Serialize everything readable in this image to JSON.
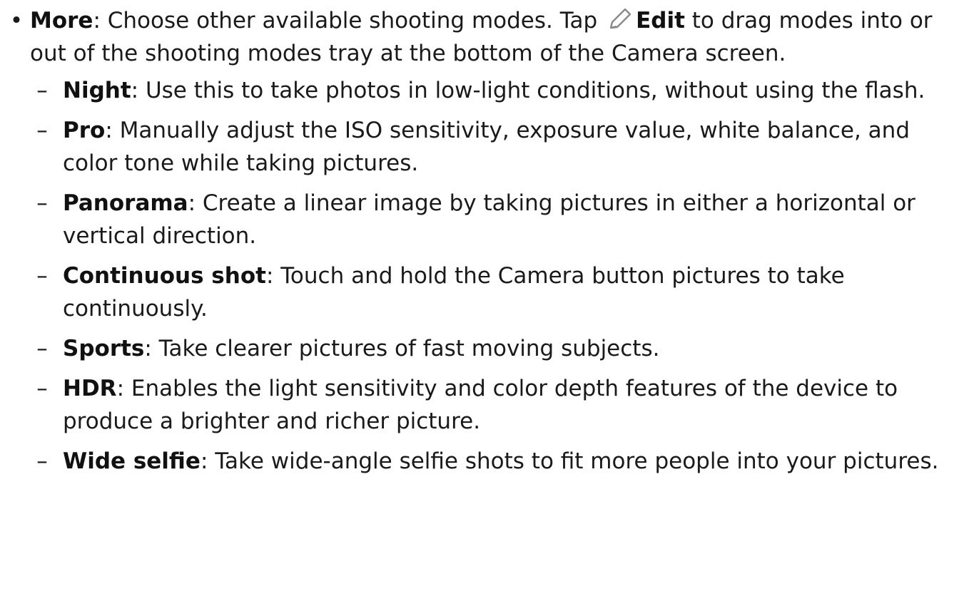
{
  "main": {
    "bullet_glyph": "•",
    "more_term": "More",
    "more_text_a": ": Choose other available shooting modes. Tap ",
    "edit_label": "Edit",
    "more_text_b": " to drag modes into or out of the shooting modes tray at the bottom of the Camera screen.",
    "edit_icon": "pencil-icon",
    "sub_items": [
      {
        "term": "Night",
        "text": ": Use this to take photos in low-light conditions, without using the flash."
      },
      {
        "term": "Pro",
        "text": ": Manually adjust the ISO sensitivity, exposure value, white balance, and color tone while taking pictures."
      },
      {
        "term": "Panorama",
        "text": ": Create a linear image by taking pictures in either a horizontal or vertical direction."
      },
      {
        "term": "Continuous shot",
        "text": ": Touch and hold the Camera button pictures to take continuously."
      },
      {
        "term": "Sports",
        "text": ": Take clearer pictures of fast moving subjects."
      },
      {
        "term": "HDR",
        "text": ": Enables the light sensitivity and color depth features of the device to produce a brighter and richer picture."
      },
      {
        "term": "Wide selfie",
        "text": ": Take wide-angle selfie shots to fit more people into your pictures."
      }
    ],
    "dash_glyph": "–"
  }
}
